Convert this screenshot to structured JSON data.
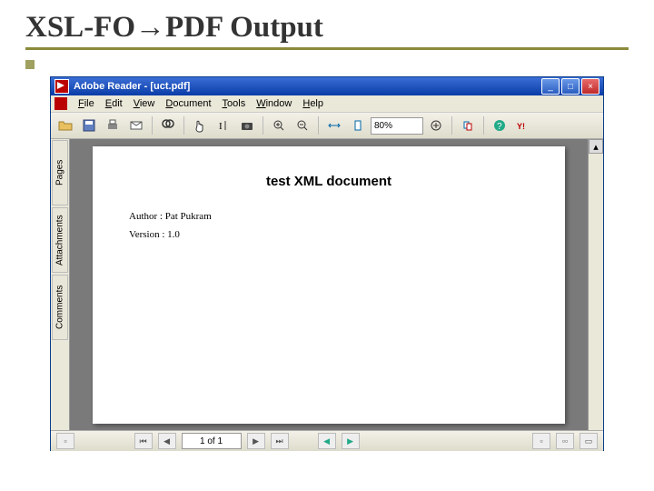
{
  "slide": {
    "title": "XSL-FO→PDF Output"
  },
  "titlebar": {
    "text": "Adobe Reader - [uct.pdf]"
  },
  "menu": {
    "file": "File",
    "edit": "Edit",
    "view": "View",
    "document": "Document",
    "tools": "Tools",
    "window": "Window",
    "help": "Help"
  },
  "toolbar": {
    "zoom": "80%"
  },
  "sidetabs": {
    "pages": "Pages",
    "attachments": "Attachments",
    "comments": "Comments"
  },
  "doc": {
    "title": "test XML document",
    "author": "Author : Pat Pukram",
    "version": "Version : 1.0"
  },
  "status": {
    "page": "1 of 1"
  }
}
